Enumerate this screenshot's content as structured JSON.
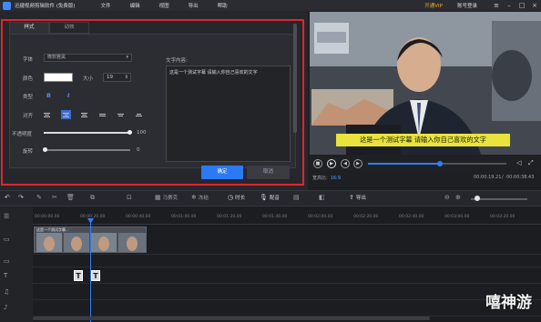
{
  "app": {
    "title": "迅捷视频剪辑软件 (免费版)",
    "menu": [
      "文件",
      "编辑",
      "视图",
      "导出",
      "帮助"
    ],
    "vip_label": "开通VIP",
    "login_label": "账号登录",
    "window_controls": [
      "minimize-icon",
      "maximize-icon",
      "close-icon"
    ]
  },
  "subtitle_panel": {
    "tabs": [
      {
        "label": "样式",
        "active": true
      },
      {
        "label": "动效",
        "active": false
      }
    ],
    "font": {
      "label": "字体",
      "value": "微软雅黑"
    },
    "color": {
      "label": "颜色",
      "value": "#ffffff"
    },
    "size": {
      "label": "大小",
      "value": "19"
    },
    "type": {
      "label": "类型",
      "options": [
        "B",
        "I"
      ]
    },
    "align": {
      "label": "对齐",
      "selected_index": 1
    },
    "opacity": {
      "label": "不透明度",
      "value": "100",
      "fraction": 1.0
    },
    "rotate": {
      "label": "旋转",
      "value": "0",
      "fraction": 0.0
    },
    "text_content": {
      "label": "文字内容:",
      "value": "这是一个测试字幕 请输入你自己喜欢的文字"
    },
    "ok_label": "确定",
    "cancel_label": "取消",
    "accent_color": "#2b79f5",
    "highlight_color": "#e0252c"
  },
  "preview": {
    "subtitle_text": "这是一个测试字幕 请输入你自己喜欢的文字",
    "subtitle_bg": "#e9e33c",
    "current_time": "00:00:19.21",
    "total_time": "00:00:38.43",
    "progress_fraction": 0.5,
    "aspect_label": "宽高比:",
    "aspect_value": "16:9"
  },
  "toolbar": {
    "items": [
      "撤销",
      "重做",
      "编辑",
      "剪切",
      "删除",
      "复制",
      "裁剪",
      "马赛克",
      "冻结",
      "时长",
      "配音",
      "导出"
    ],
    "labels": {
      "mosaic": "马赛克",
      "freeze": "冻结",
      "duration": "时长",
      "dub": "配音",
      "export": "导出"
    }
  },
  "timeline": {
    "ticks": [
      "00:00:00.00",
      "00:00:20.00",
      "00:00:40.00",
      "00:01:00.00",
      "00:01:20.00",
      "00:01:40.00",
      "00:02:00.00",
      "00:02:20.00",
      "00:02:40.00",
      "00:03:00.00",
      "00:03:20.00"
    ],
    "clip_label": "这是一个测试字幕...",
    "text_tiles": [
      "T",
      "T"
    ],
    "track_icons": [
      "video-track-icon",
      "audio-track-icon",
      "text-track-icon",
      "music-track-icon",
      "voice-track-icon"
    ]
  },
  "watermark": "嘻神游"
}
